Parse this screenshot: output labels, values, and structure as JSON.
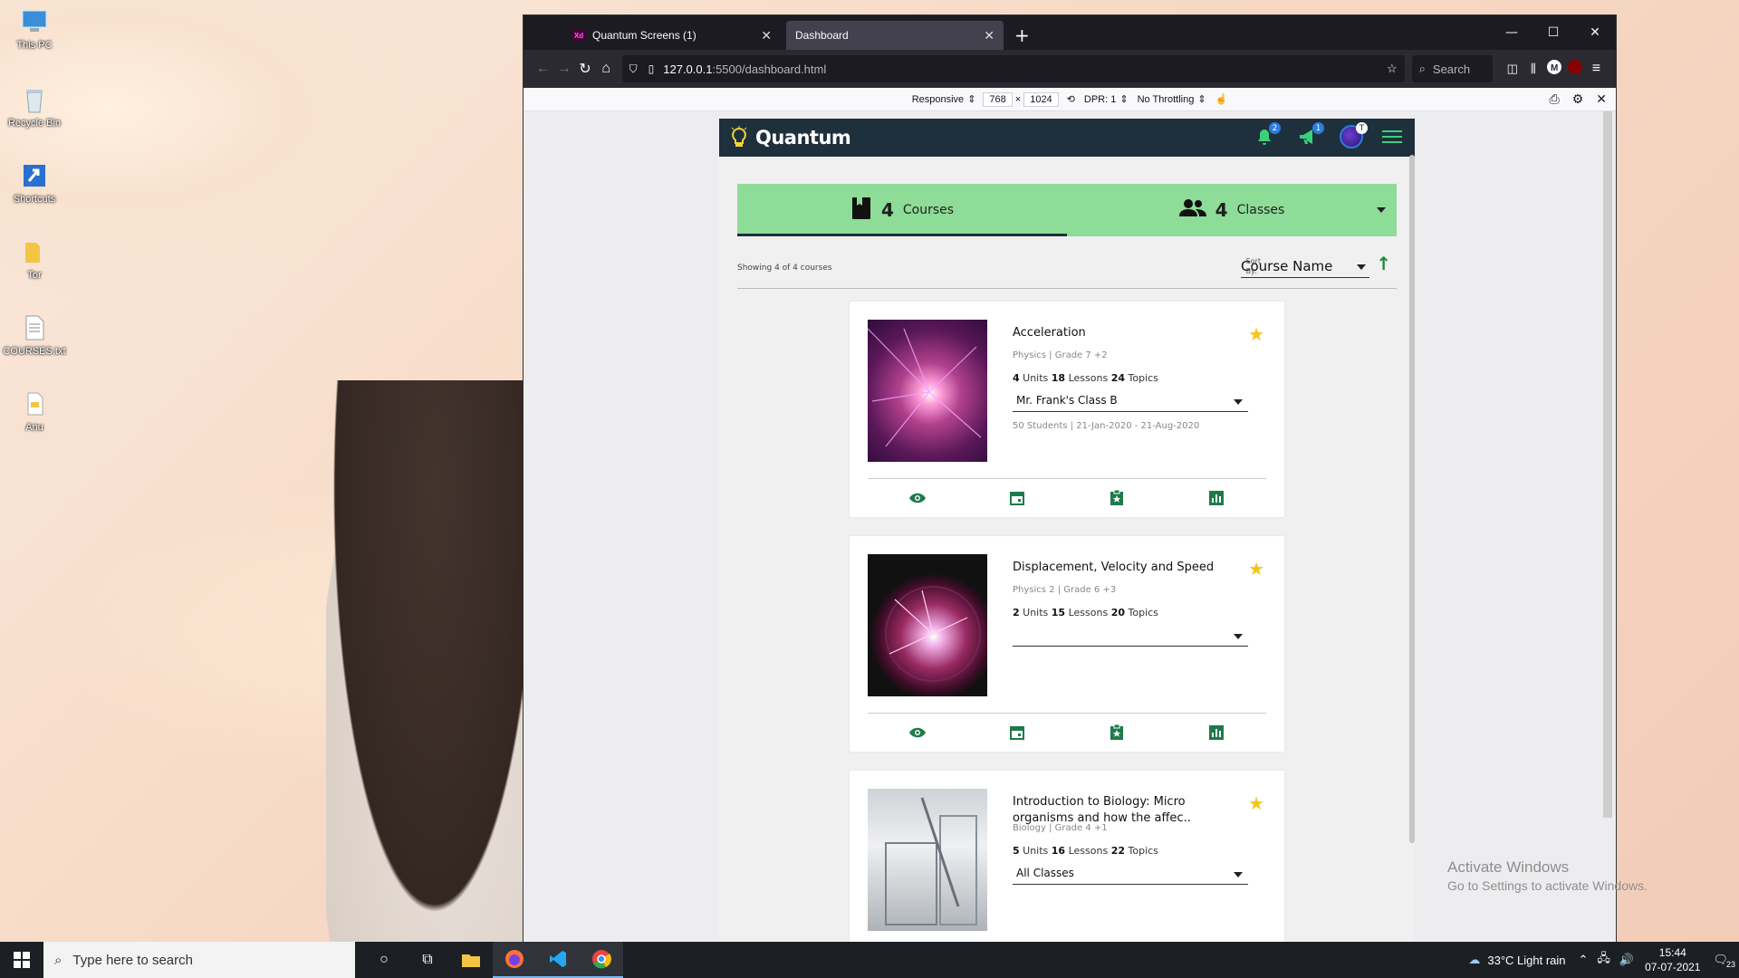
{
  "desktop": {
    "icons": [
      {
        "label": "This PC",
        "icon": "computer-icon"
      },
      {
        "label": "Recycle Bin",
        "icon": "recycle-bin-icon"
      },
      {
        "label": "Shortcuts",
        "icon": "shortcut-icon"
      },
      {
        "label": "Tor",
        "icon": "folder-icon"
      },
      {
        "label": "COURSES.txt",
        "icon": "text-file-icon"
      },
      {
        "label": "Anu",
        "icon": "file-icon"
      }
    ],
    "activate_title": "Activate Windows",
    "activate_sub": "Go to Settings to activate Windows."
  },
  "browser": {
    "tabs": [
      {
        "label": "Quantum Screens (1)",
        "icon": "adobe-xd-icon"
      },
      {
        "label": "Dashboard"
      }
    ],
    "xd_label": "Xd",
    "url_host": "127.0.0.1",
    "url_path": ":5500/dashboard.html",
    "search_placeholder": "Search",
    "rdm": {
      "device": "Responsive",
      "width": "768",
      "height": "1024",
      "dpr": "DPR: 1",
      "throttle": "No Throttling"
    }
  },
  "app": {
    "brand": "Quantum",
    "notif_count": "2",
    "announce_count": "1",
    "avatar_badge": "T",
    "summary": {
      "courses_count": "4",
      "courses_label": "Courses",
      "classes_count": "4",
      "classes_label": "Classes"
    },
    "showing": "Showing 4 of 4 courses",
    "sort_label_1": "Sort",
    "sort_label_2": "By:",
    "sort_value": "Course Name",
    "courses": [
      {
        "title": "Acceleration",
        "meta": "Physics  |  Grade 7 +2",
        "units": "4",
        "lessons": "18",
        "topics": "24",
        "class": "Mr. Frank's Class B",
        "students": "50 Students   |   21-Jan-2020 - 21-Aug-2020",
        "starred": true
      },
      {
        "title": "Displacement, Velocity and Speed",
        "meta": "Physics 2  |  Grade 6 +3",
        "units": "2",
        "lessons": "15",
        "topics": "20",
        "class": "",
        "students": "",
        "starred": true
      },
      {
        "title": "Introduction to Biology: Micro organisms and how the affec..",
        "meta": "Biology  |  Grade 4 +1",
        "units": "5",
        "lessons": "16",
        "topics": "22",
        "class": "All Classes",
        "students": "",
        "starred": true
      }
    ],
    "units_label": "Units",
    "lessons_label": "Lessons",
    "topics_label": "Topics"
  },
  "taskbar": {
    "search_placeholder": "Type here to search",
    "weather": "33°C  Light rain",
    "time": "15:44",
    "date": "07-07-2021",
    "notifications": "23"
  },
  "colors": {
    "header": "#1f303d",
    "accent_green": "#8ddc97",
    "icon_green": "#1e7a4a",
    "star": "#f5c518"
  }
}
